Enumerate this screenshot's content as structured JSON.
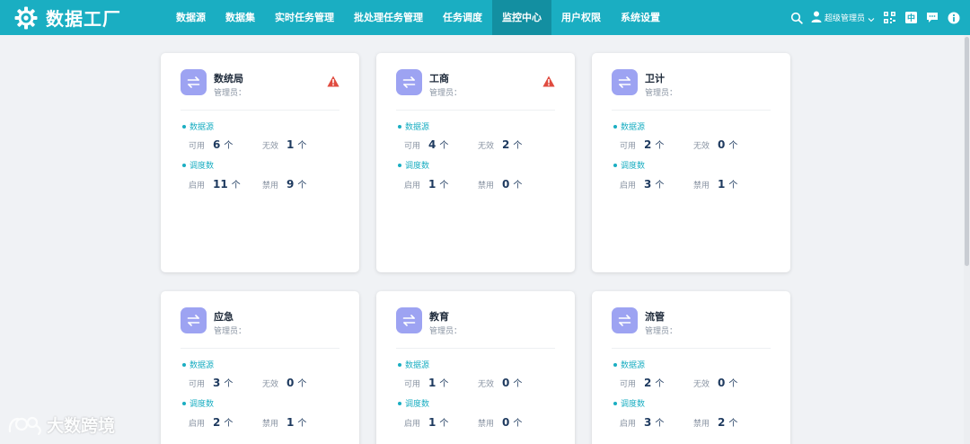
{
  "app": {
    "name": "数据工厂"
  },
  "nav": {
    "items": [
      {
        "label": "数据源",
        "active": false
      },
      {
        "label": "数据集",
        "active": false
      },
      {
        "label": "实时任务管理",
        "active": false
      },
      {
        "label": "批处理任务管理",
        "active": false
      },
      {
        "label": "任务调度",
        "active": false
      },
      {
        "label": "监控中心",
        "active": true
      },
      {
        "label": "用户权限",
        "active": false
      },
      {
        "label": "系统设置",
        "active": false
      }
    ]
  },
  "header": {
    "user_name": "超级管理员",
    "icons": [
      "search-icon",
      "user-icon",
      "chevron-down-icon",
      "qrcode-icon",
      "translate-icon",
      "message-icon",
      "info-icon"
    ]
  },
  "labels": {
    "admin": "管理员：",
    "datasource": "数据源",
    "schedule": "调度数",
    "available": "可用",
    "invalid": "无效",
    "enabled": "启用",
    "disabled": "禁用",
    "unit": "个"
  },
  "cards": [
    {
      "title": "数统局",
      "warning": true,
      "ds_available": "6",
      "ds_invalid": "1",
      "sch_enabled": "11",
      "sch_disabled": "9"
    },
    {
      "title": "工商",
      "warning": true,
      "ds_available": "4",
      "ds_invalid": "2",
      "sch_enabled": "1",
      "sch_disabled": "0"
    },
    {
      "title": "卫计",
      "warning": false,
      "ds_available": "2",
      "ds_invalid": "0",
      "sch_enabled": "3",
      "sch_disabled": "1"
    },
    {
      "title": "应急",
      "warning": false,
      "ds_available": "3",
      "ds_invalid": "0",
      "sch_enabled": "2",
      "sch_disabled": "1"
    },
    {
      "title": "教育",
      "warning": false,
      "ds_available": "1",
      "ds_invalid": "0",
      "sch_enabled": "1",
      "sch_disabled": "0"
    },
    {
      "title": "流管",
      "warning": false,
      "ds_available": "2",
      "ds_invalid": "0",
      "sch_enabled": "3",
      "sch_disabled": "2"
    }
  ],
  "watermark": {
    "text": "大数跨境"
  },
  "colors": {
    "topbar": "#1aaec2",
    "nav_active": "#138fa1",
    "accent": "#1aaec2",
    "avatar": "#9da3f2",
    "warning": "#e04b3f",
    "number": "#1e3a5f"
  }
}
